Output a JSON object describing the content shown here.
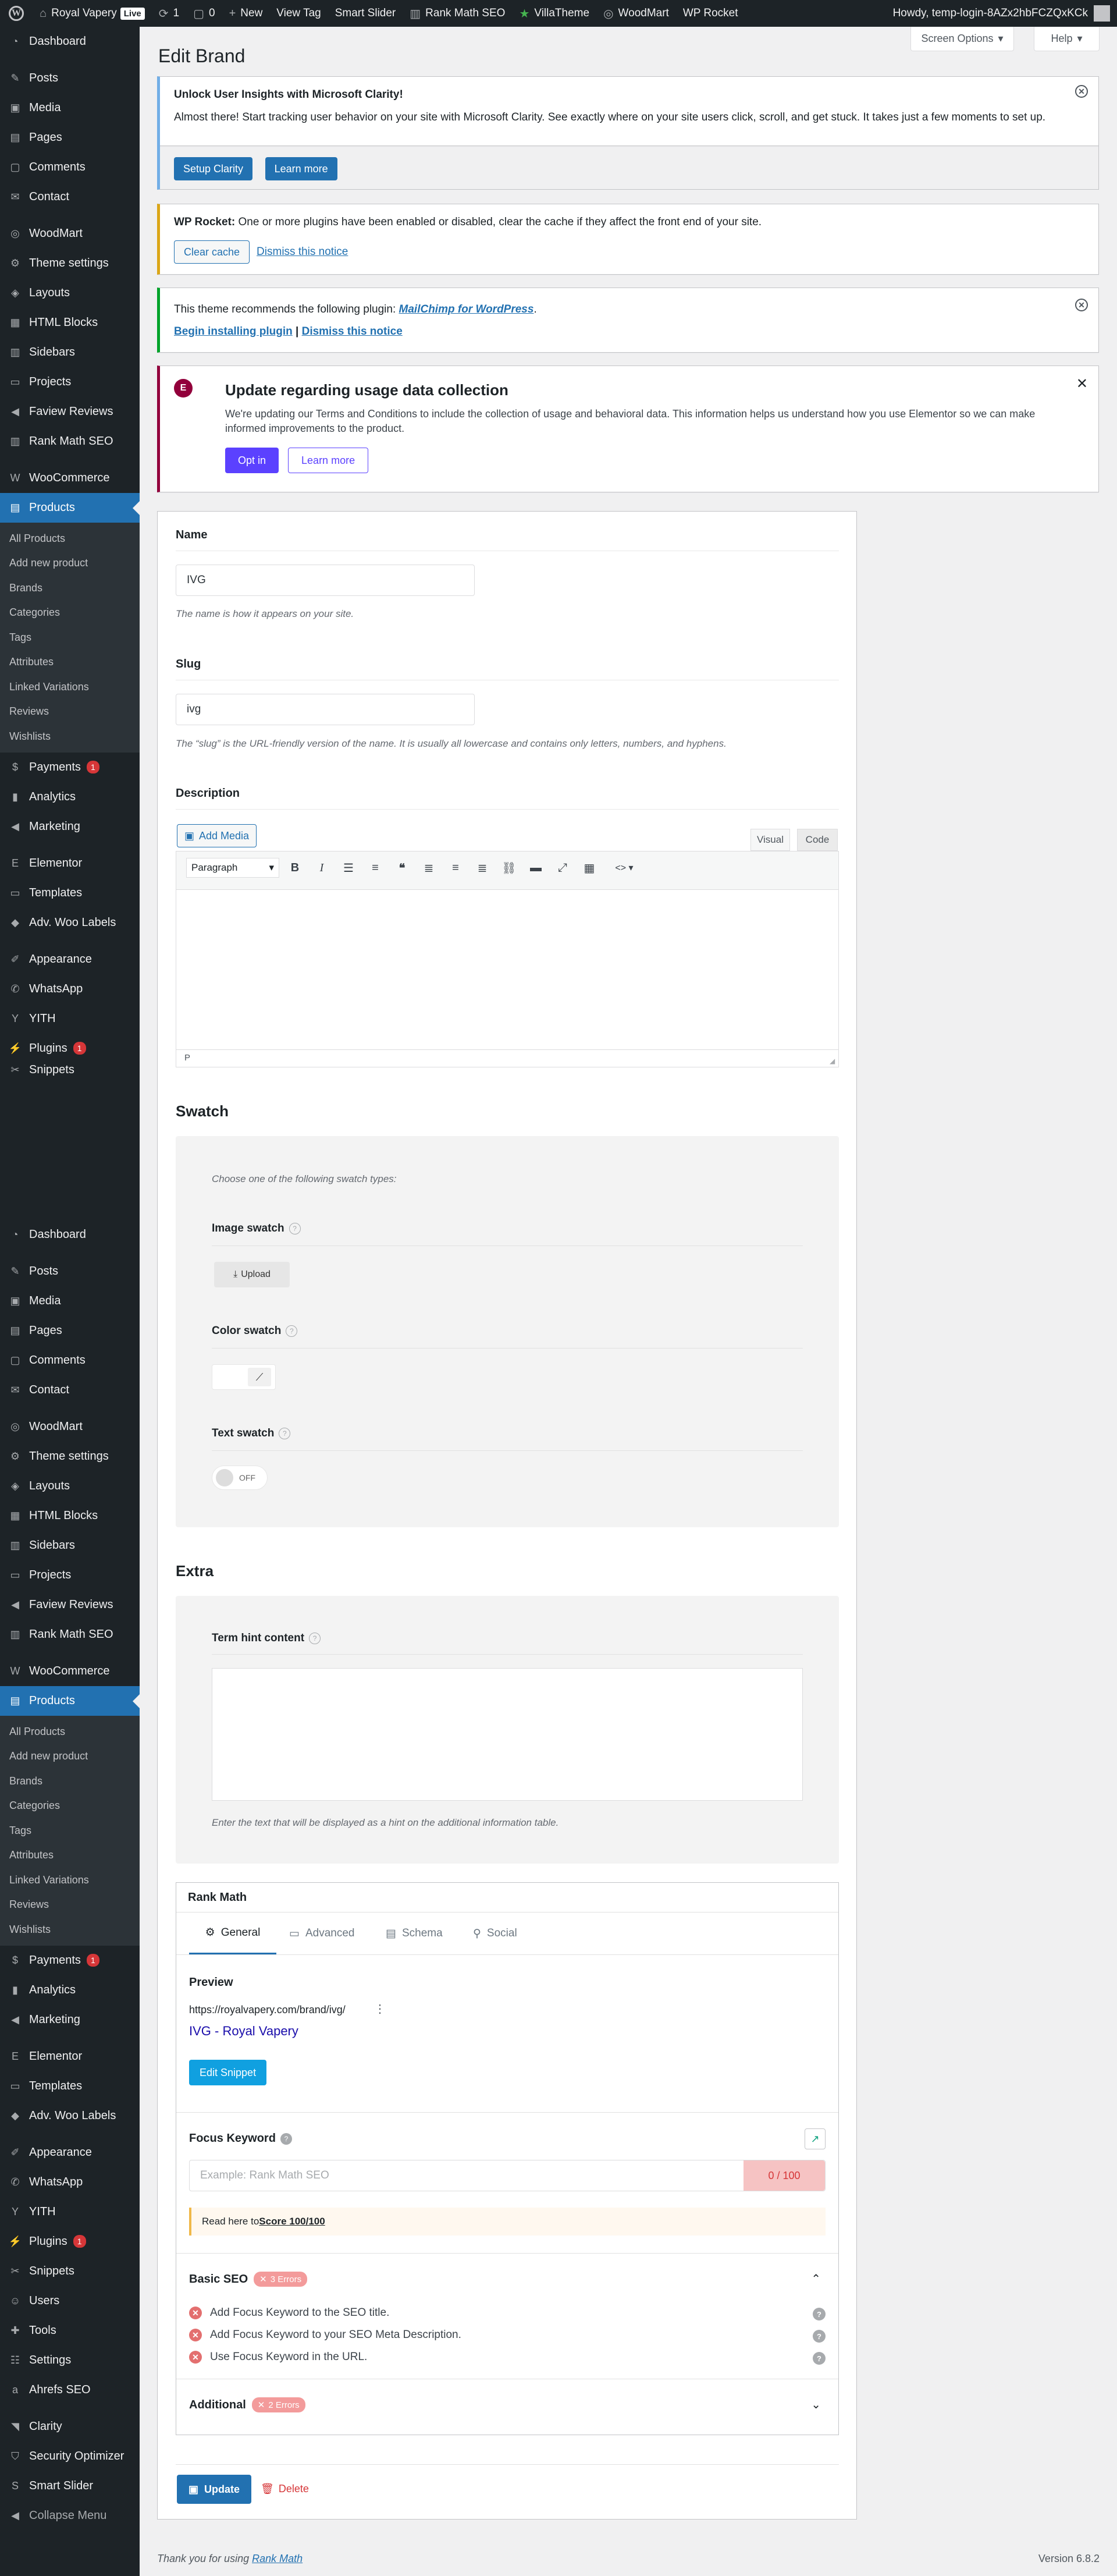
{
  "adminbar": {
    "site_name": "Royal Vapery",
    "live_badge": "Live",
    "updates_count": "1",
    "comments_count": "0",
    "new_label": "New",
    "view_tag": "View Tag",
    "smart_slider": "Smart Slider",
    "rank_math": "Rank Math SEO",
    "villatheme": "VillaTheme",
    "woodmart": "WoodMart",
    "wp_rocket": "WP Rocket",
    "howdy": "Howdy, temp-login-8AZx2hbFCZQxKCk"
  },
  "menu": {
    "items": [
      {
        "label": "Dashboard",
        "icon": "dashboard-icon"
      },
      {
        "label": "Posts",
        "icon": "pin-icon"
      },
      {
        "label": "Media",
        "icon": "media-icon"
      },
      {
        "label": "Pages",
        "icon": "pages-icon"
      },
      {
        "label": "Comments",
        "icon": "comments-icon"
      },
      {
        "label": "Contact",
        "icon": "mail-icon"
      },
      {
        "label": "WoodMart",
        "icon": "woodmart-icon"
      },
      {
        "label": "Theme settings",
        "icon": "gear-icon"
      },
      {
        "label": "Layouts",
        "icon": "layers-icon"
      },
      {
        "label": "HTML Blocks",
        "icon": "blocks-icon"
      },
      {
        "label": "Sidebars",
        "icon": "sidebar-icon"
      },
      {
        "label": "Projects",
        "icon": "folder-icon"
      },
      {
        "label": "Faview Reviews",
        "icon": "megaphone-icon"
      },
      {
        "label": "Rank Math SEO",
        "icon": "chart-icon"
      },
      {
        "label": "WooCommerce",
        "icon": "woo-icon"
      },
      {
        "label": "Products",
        "icon": "archive-icon"
      }
    ],
    "products_sub": [
      "All Products",
      "Add new product",
      "Brands",
      "Categories",
      "Tags",
      "Attributes",
      "Linked Variations",
      "Reviews",
      "Wishlists"
    ],
    "items_after": [
      {
        "label": "Payments",
        "icon": "dollar-icon",
        "badge": "1"
      },
      {
        "label": "Analytics",
        "icon": "bar-chart-icon"
      },
      {
        "label": "Marketing",
        "icon": "megaphone-icon"
      },
      {
        "label": "Elementor",
        "icon": "elementor-icon"
      },
      {
        "label": "Templates",
        "icon": "folder-icon"
      },
      {
        "label": "Adv. Woo Labels",
        "icon": "tag-icon"
      },
      {
        "label": "Appearance",
        "icon": "brush-icon"
      },
      {
        "label": "WhatsApp",
        "icon": "whatsapp-icon"
      },
      {
        "label": "YITH",
        "icon": "yith-icon"
      },
      {
        "label": "Plugins",
        "icon": "plugin-icon",
        "badge": "1"
      },
      {
        "label": "Snippets",
        "icon": "scissors-icon"
      }
    ],
    "items_tail": [
      {
        "label": "Users",
        "icon": "user-icon"
      },
      {
        "label": "Tools",
        "icon": "wrench-icon"
      },
      {
        "label": "Settings",
        "icon": "settings-icon"
      },
      {
        "label": "Ahrefs SEO",
        "icon": "ahrefs-icon"
      },
      {
        "label": "Clarity",
        "icon": "clarity-icon"
      },
      {
        "label": "Security Optimizer",
        "icon": "shield-icon"
      },
      {
        "label": "Smart Slider",
        "icon": "slider-icon"
      }
    ],
    "collapse": "Collapse Menu"
  },
  "screen_options": "Screen Options",
  "help": "Help",
  "page_title": "Edit Brand",
  "notices": {
    "clarity": {
      "title": "Unlock User Insights with Microsoft Clarity!",
      "body": "Almost there! Start tracking user behavior on your site with Microsoft Clarity. See exactly where on your site users click, scroll, and get stuck. It takes just a few moments to set up.",
      "setup": "Setup Clarity",
      "learn": "Learn more"
    },
    "rocket": {
      "strong": "WP Rocket:",
      "body": " One or more plugins have been enabled or disabled, clear the cache if they affect the front end of your site.",
      "clear": "Clear cache",
      "dismiss": "Dismiss this notice"
    },
    "theme": {
      "body": "This theme recommends the following plugin: ",
      "plugin": "MailChimp for WordPress",
      "period": ".",
      "install": "Begin installing plugin",
      "sep": " | ",
      "dismiss": "Dismiss this notice"
    },
    "elementor": {
      "title": "Update regarding usage data collection",
      "body": "We're updating our Terms and Conditions to include the collection of usage and behavioral data. This information helps us understand how you use Elementor so we can make informed improvements to the product.",
      "optin": "Opt in",
      "learn": "Learn more"
    }
  },
  "form": {
    "name_label": "Name",
    "name_value": "IVG",
    "name_desc": "The name is how it appears on your site.",
    "slug_label": "Slug",
    "slug_value": "ivg",
    "slug_desc": "The “slug” is the URL-friendly version of the name. It is usually all lowercase and contains only letters, numbers, and hyphens.",
    "desc_label": "Description",
    "add_media": "Add Media",
    "tab_visual": "Visual",
    "tab_code": "Code",
    "format": "Paragraph",
    "path": "P"
  },
  "swatch": {
    "title": "Swatch",
    "hint": "Choose one of the following swatch types:",
    "image_label": "Image swatch",
    "upload": "Upload",
    "color_label": "Color swatch",
    "text_label": "Text swatch",
    "toggle": "OFF"
  },
  "extra": {
    "title": "Extra",
    "term_hint_label": "Term hint content",
    "term_hint_desc": "Enter the text that will be displayed as a hint on the additional information table."
  },
  "rankmath": {
    "title": "Rank Math",
    "tabs": [
      "General",
      "Advanced",
      "Schema",
      "Social"
    ],
    "preview_label": "Preview",
    "preview_url": "https://royalvapery.com/brand/ivg/",
    "preview_title": "IVG - Royal Vapery",
    "edit_snippet": "Edit Snippet",
    "focus_label": "Focus Keyword",
    "focus_placeholder": "Example: Rank Math SEO",
    "focus_count": "0 / 100",
    "read_here": "Read here to ",
    "score_link": "Score 100/100",
    "basic_seo": "Basic SEO",
    "basic_errors": "3 Errors",
    "checks": [
      "Add Focus Keyword to the SEO title.",
      "Add Focus Keyword to your SEO Meta Description.",
      "Use Focus Keyword in the URL."
    ],
    "additional": "Additional",
    "additional_errors": "2 Errors"
  },
  "actions": {
    "update": "Update",
    "delete": "Delete"
  },
  "footer": {
    "thanks": "Thank you for using ",
    "link": "Rank Math",
    "version": "Version 6.8.2"
  }
}
